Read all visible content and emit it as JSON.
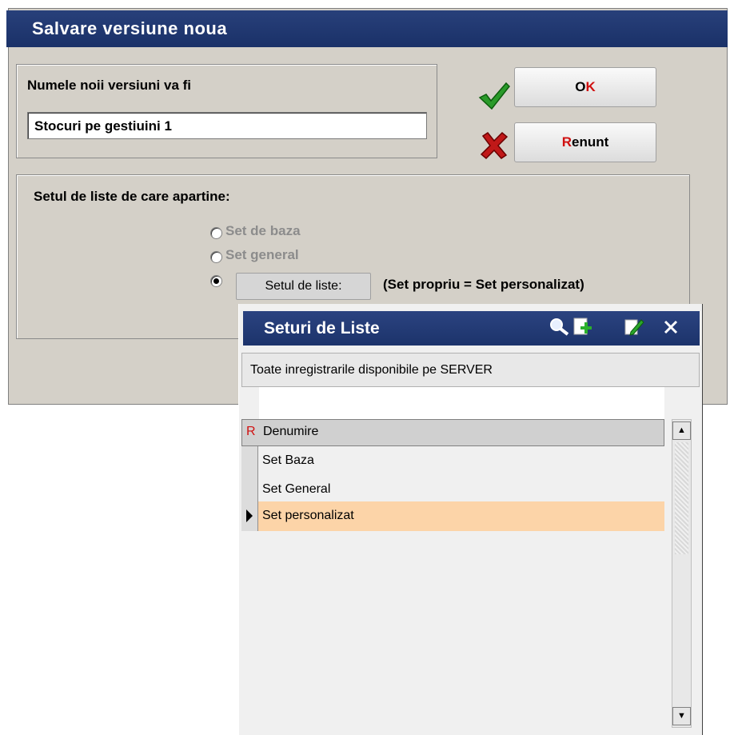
{
  "dialog": {
    "title": "Salvare versiune noua",
    "name_label": "Numele noii versiuni va fi",
    "name_value": "Stocuri pe gestiuini 1",
    "ok_hotkey": "O",
    "ok_rest": "K",
    "cancel_hotkey": "R",
    "cancel_rest": "enunt",
    "set_group_label": "Setul de liste de care apartine:",
    "radio_options": [
      "Set de baza",
      "Set general"
    ],
    "set_button_label": "Setul de liste:",
    "set_value": "(Set propriu = Set personalizat)"
  },
  "popup": {
    "title": "Seturi de Liste",
    "icons": [
      "search-icon",
      "add-icon",
      "edit-icon",
      "close-icon"
    ],
    "subtitle": "Toate inregistrarile disponibile pe SERVER",
    "column_marker": "R",
    "column_header": "Denumire",
    "rows": [
      "Set Baza",
      "Set General",
      "Set personalizat"
    ],
    "selected_row": 2,
    "colors": {
      "selected_row_bg": "#fcd4a8",
      "title_bg": "#1f386f",
      "hotkey": "#d01010"
    }
  }
}
